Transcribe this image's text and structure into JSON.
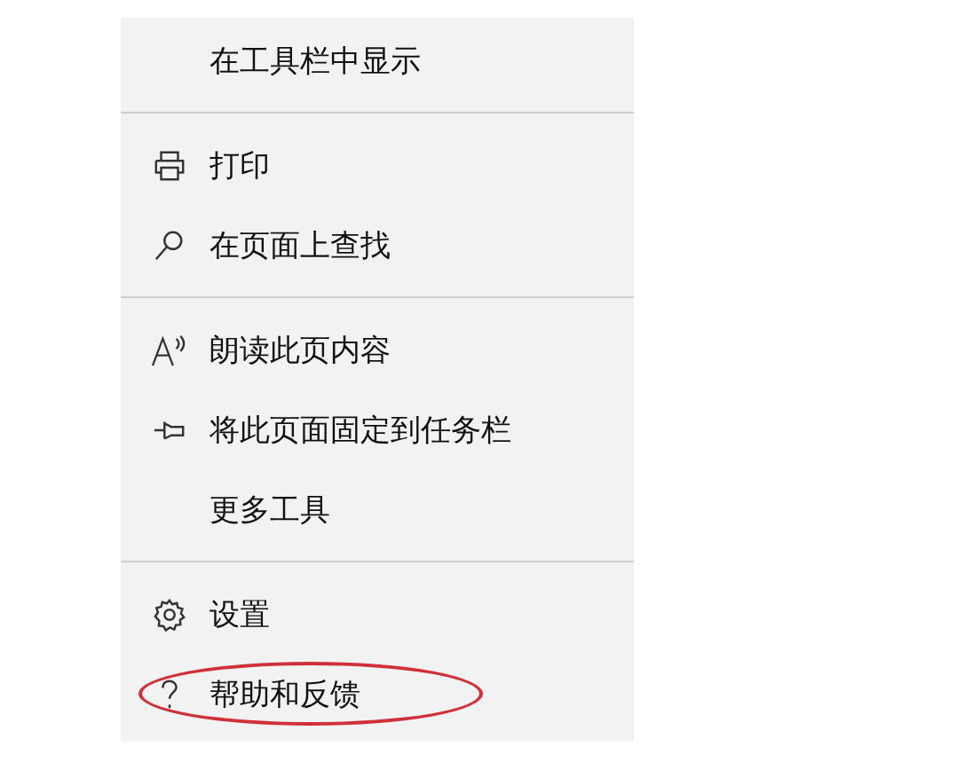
{
  "menu": {
    "sections": [
      [
        {
          "label": "在工具栏中显示",
          "circled": false
        }
      ],
      [
        {
          "label": "打印",
          "circled": false
        },
        {
          "label": "在页面上查找",
          "circled": false
        }
      ],
      [
        {
          "label": "朗读此页内容",
          "circled": false
        },
        {
          "label": "将此页面固定到任务栏",
          "circled": false
        },
        {
          "label": "更多工具",
          "circled": false
        }
      ],
      [
        {
          "label": "设置",
          "circled": false
        },
        {
          "label": "帮助和反馈",
          "circled": true
        }
      ]
    ]
  }
}
